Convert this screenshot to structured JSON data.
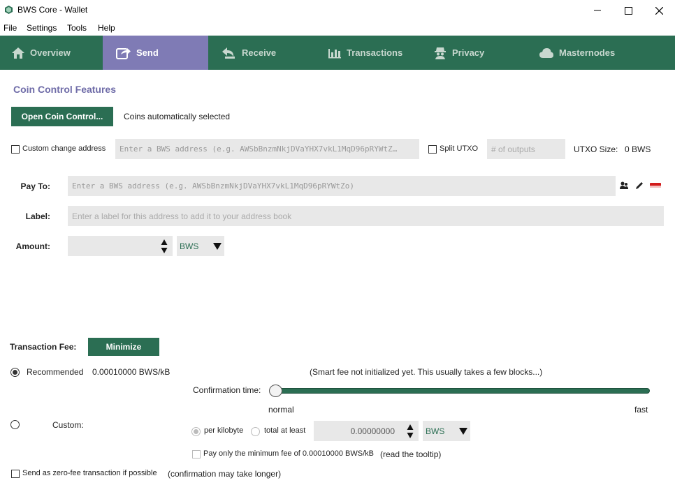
{
  "window": {
    "title": "BWS Core - Wallet"
  },
  "menu": [
    "File",
    "Settings",
    "Tools",
    "Help"
  ],
  "tabs": [
    {
      "label": "Overview",
      "icon": "home-icon",
      "active": false
    },
    {
      "label": "Send",
      "icon": "send-icon",
      "active": true
    },
    {
      "label": "Receive",
      "icon": "receive-icon",
      "active": false
    },
    {
      "label": "Transactions",
      "icon": "transactions-icon",
      "active": false
    },
    {
      "label": "Privacy",
      "icon": "privacy-icon",
      "active": false
    },
    {
      "label": "Masternodes",
      "icon": "cloud-icon",
      "active": false
    }
  ],
  "coin_control": {
    "title": "Coin Control Features",
    "button_label": "Open Coin Control...",
    "status": "Coins automatically selected",
    "custom_change_label": "Custom change address",
    "custom_change_placeholder": "Enter a BWS address (e.g. AWSbBnzmNkjDVaYHX7vkL1MqD96pRYWtZ…",
    "split_utxo_label": "Split UTXO",
    "outputs_placeholder": "# of outputs",
    "utxo_size_label": "UTXO Size:",
    "utxo_size_value": "0 BWS"
  },
  "recipient": {
    "pay_to_label": "Pay To:",
    "pay_to_placeholder": "Enter a BWS address (e.g. AWSbBnzmNkjDVaYHX7vkL1MqD96pRYWtZo)",
    "label_label": "Label:",
    "label_placeholder": "Enter a label for this address to add it to your address book",
    "amount_label": "Amount:",
    "amount_value": "",
    "unit": "BWS"
  },
  "fee": {
    "label": "Transaction Fee:",
    "minimize_label": "Minimize",
    "recommended_label": "Recommended",
    "recommended_value": "0.00010000 BWS/kB",
    "smart_fee_note": "(Smart fee not initialized yet. This usually takes a few blocks...)",
    "confirmation_label": "Confirmation time:",
    "slider_min_label": "normal",
    "slider_max_label": "fast",
    "slider_position": 0,
    "custom_label": "Custom:",
    "per_kilobyte_label": "per kilobyte",
    "total_at_least_label": "total at least",
    "custom_value": "0.00000000",
    "custom_unit": "BWS",
    "pay_minimum_label": "Pay only the minimum fee of 0.00010000 BWS/kB",
    "tooltip_note": "(read the tooltip)",
    "zero_fee_label": "Send as zero-fee transaction if possible",
    "zero_fee_note": "(confirmation may take longer)"
  },
  "colors": {
    "accent": "#2b6e53",
    "active_tab": "#7f7bb5",
    "heading": "#6f6ca8"
  }
}
